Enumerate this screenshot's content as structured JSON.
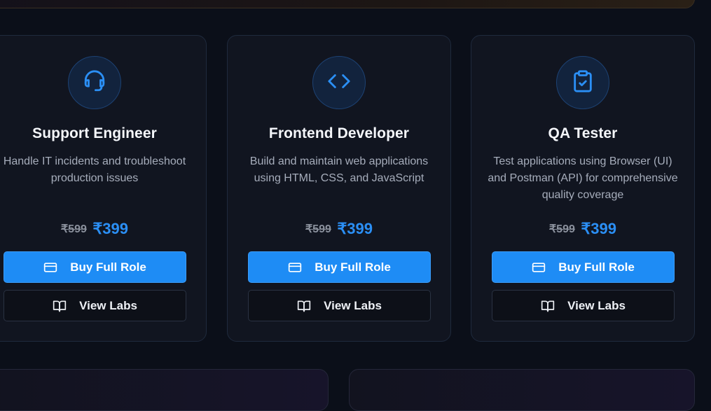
{
  "cards": [
    {
      "title": "Support Engineer",
      "description": "Handle IT incidents and troubleshoot production issues",
      "old_price": "₹599",
      "new_price": "₹399",
      "buy_label": "Buy Full Role",
      "view_label": "View Labs",
      "icon": "headset-icon"
    },
    {
      "title": "Frontend Developer",
      "description": "Build and maintain web applications using HTML, CSS, and JavaScript",
      "old_price": "₹599",
      "new_price": "₹399",
      "buy_label": "Buy Full Role",
      "view_label": "View Labs",
      "icon": "code-icon"
    },
    {
      "title": "QA Tester",
      "description": "Test applications using Browser (UI) and Postman (API) for comprehensive quality coverage",
      "old_price": "₹599",
      "new_price": "₹399",
      "buy_label": "Buy Full Role",
      "view_label": "View Labs",
      "icon": "clipboard-check-icon"
    }
  ],
  "colors": {
    "accent": "#1e8cf5",
    "price": "#2b8ff5",
    "background": "#0b0f19",
    "card": "#111520"
  }
}
